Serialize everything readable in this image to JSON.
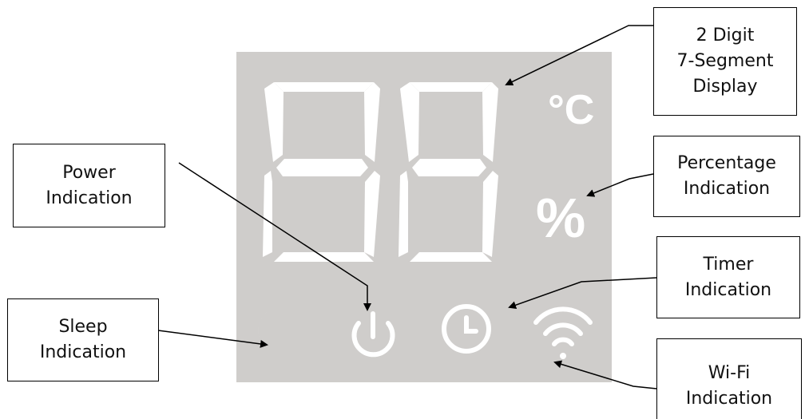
{
  "labels": {
    "display": [
      "2 Digit",
      "7-Segment",
      "Display"
    ],
    "percentage": [
      "Percentage",
      "Indication"
    ],
    "power": [
      "Power",
      "Indication"
    ],
    "timer": [
      "Timer",
      "Indication"
    ],
    "sleep": [
      "Sleep",
      "Indication"
    ],
    "wifi": [
      "Wi-Fi",
      "Indication"
    ]
  },
  "panel_symbols": {
    "celsius": "°C",
    "percent": "%"
  },
  "icons": [
    "seven-segment-digit",
    "celsius-icon",
    "percent-icon",
    "moon-icon",
    "power-icon",
    "clock-icon",
    "wifi-icon"
  ],
  "colors": {
    "panel_background": "#cfcdcb",
    "segment_glow": "#ffffff",
    "callout_border": "#000000",
    "arrow": "#000000"
  }
}
